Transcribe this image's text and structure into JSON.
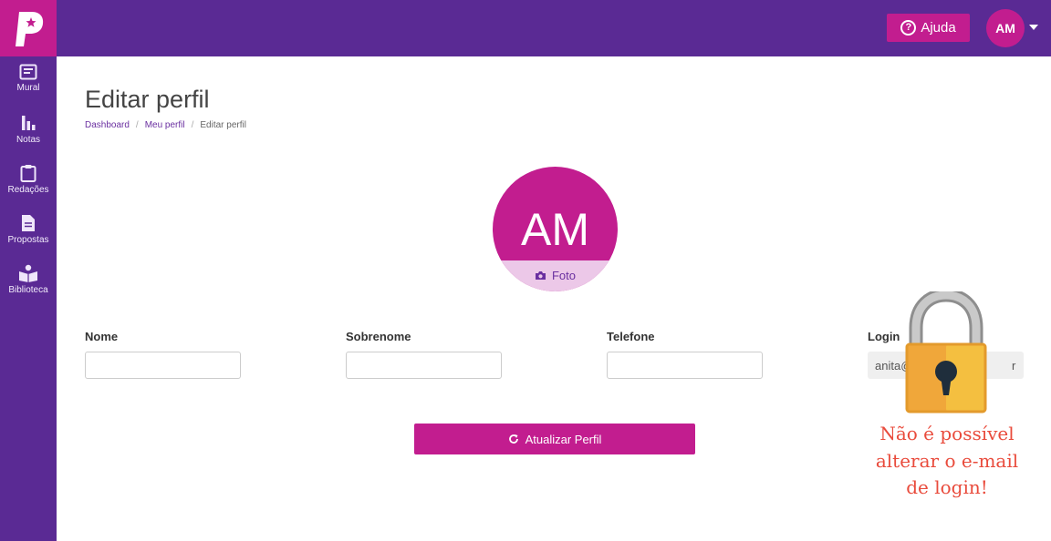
{
  "brand": {
    "logo_letter": "P"
  },
  "header": {
    "help_label": "Ajuda",
    "help_icon": "question-circle-icon",
    "user_initials": "AM"
  },
  "sidebar": {
    "items": [
      {
        "label": "Mural",
        "icon": "board-icon"
      },
      {
        "label": "Notas",
        "icon": "bar-chart-icon"
      },
      {
        "label": "Redações",
        "icon": "clipboard-icon"
      },
      {
        "label": "Propostas",
        "icon": "document-icon"
      },
      {
        "label": "Biblioteca",
        "icon": "reader-icon"
      }
    ]
  },
  "page": {
    "title": "Editar perfil",
    "breadcrumb": [
      "Dashboard",
      "Meu perfil",
      "Editar perfil"
    ]
  },
  "profile": {
    "initials": "AM",
    "photo_label": "Foto"
  },
  "form": {
    "fields": [
      {
        "label": "Nome",
        "value": ""
      },
      {
        "label": "Sobrenome",
        "value": ""
      },
      {
        "label": "Telefone",
        "value": ""
      },
      {
        "label": "Login",
        "value": "anita@"
      }
    ],
    "login_suffix": "r",
    "submit_label": "Atualizar Perfil"
  },
  "overlay": {
    "lock_icon": "padlock-icon",
    "message_lines": [
      "Não é possível",
      "alterar o e-mail",
      "de login!"
    ]
  },
  "colors": {
    "primary_purple": "#5a2a94",
    "accent_magenta": "#c21d8f",
    "photo_band": "#ecc8e8",
    "warning_red": "#e94b3c"
  }
}
